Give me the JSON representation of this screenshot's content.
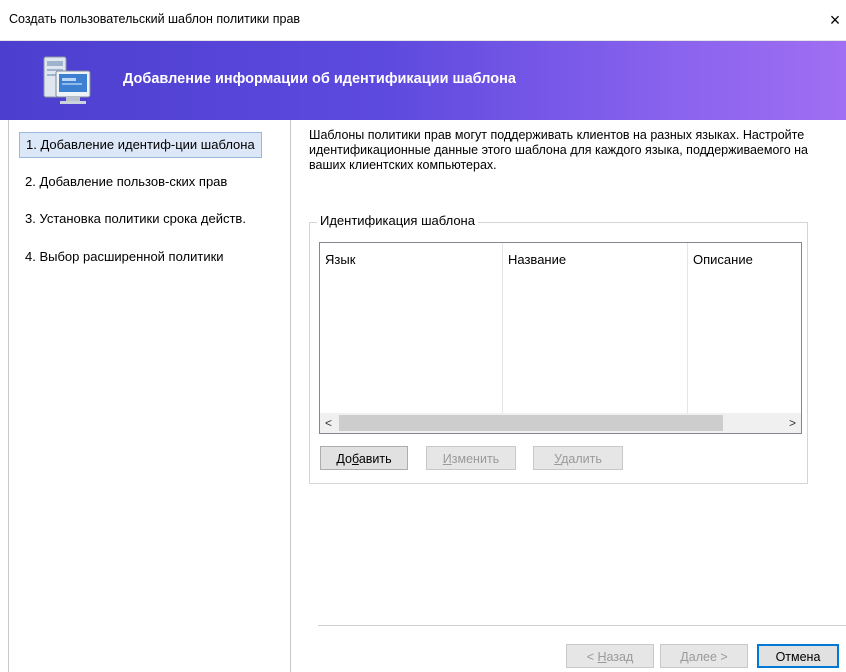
{
  "window": {
    "title": "Создать пользовательский шаблон политики прав",
    "close_glyph": "×"
  },
  "banner": {
    "title": "Добавление информации об идентификации шаблона",
    "icon": "computer-policy-icon"
  },
  "steps": [
    {
      "label": "1. Добавление идентиф-ции шаблона",
      "active": true
    },
    {
      "label": "2. Добавление пользов-ских прав",
      "active": false
    },
    {
      "label": "3. Установка политики срока действ.",
      "active": false
    },
    {
      "label": "4. Выбор расширенной политики",
      "active": false
    }
  ],
  "description": "Шаблоны политики прав могут поддерживать клиентов на разных языках. Настройте идентификационные данные этого шаблона для каждого языка, поддерживаемого на ваших клиентских компьютерах.",
  "group": {
    "label": "Идентификация шаблона",
    "columns": [
      "Язык",
      "Название",
      "Описание"
    ],
    "rows": [],
    "scroll_left": "<",
    "scroll_right": ">"
  },
  "group_buttons": {
    "add": {
      "pre": "До",
      "key": "б",
      "post": "авить"
    },
    "edit": {
      "pre": "",
      "key": "И",
      "post": "зменить"
    },
    "delete": {
      "pre": "",
      "key": "У",
      "post": "далить"
    }
  },
  "nav": {
    "back": {
      "pre": "< ",
      "key": "Н",
      "post": "азад"
    },
    "next": {
      "pre": "",
      "key": "Д",
      "post": "алее >"
    },
    "cancel": "Отмена"
  },
  "colors": {
    "banner_start": "#4c3fcf",
    "banner_end": "#a06ff2",
    "active_step_bg": "#dce8f7",
    "default_button_border": "#0078d7"
  }
}
